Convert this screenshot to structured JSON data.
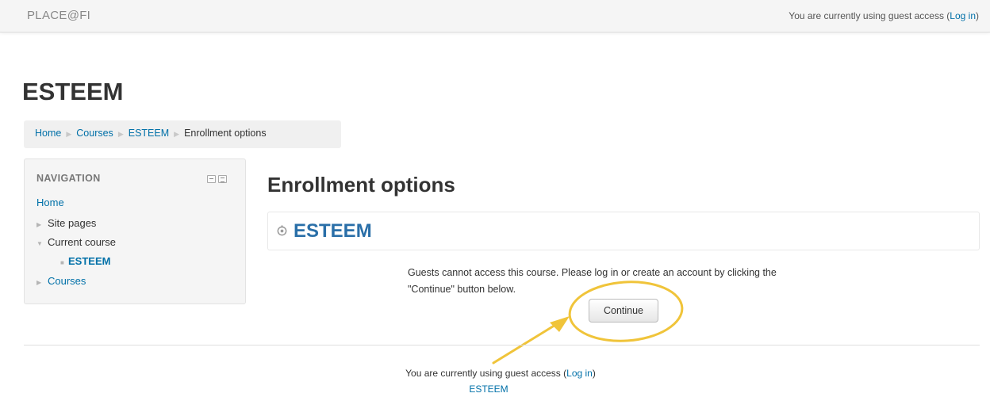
{
  "header": {
    "brand": "PLACE@FI",
    "login_prefix": "You are currently using guest access (",
    "login_link": "Log in",
    "login_suffix": ")"
  },
  "page": {
    "heading": "ESTEEM"
  },
  "breadcrumb": [
    {
      "label": "Home"
    },
    {
      "label": "Courses"
    },
    {
      "label": "ESTEEM"
    },
    {
      "label": "Enrollment options"
    }
  ],
  "navigation": {
    "title": "NAVIGATION",
    "home": "Home",
    "site_pages": "Site pages",
    "current_course": "Current course",
    "course": "ESTEEM",
    "courses": "Courses"
  },
  "main": {
    "title": "Enrollment options",
    "course_name": "ESTEEM",
    "message": "Guests cannot access this course. Please log in or create an account by clicking the \"Continue\" button below.",
    "continue_label": "Continue"
  },
  "annotation": {
    "color": "#f0c43a"
  },
  "footer": {
    "login_prefix": "You are currently using guest access (",
    "login_link": "Log in",
    "login_suffix": ")",
    "course_link": "ESTEEM"
  }
}
